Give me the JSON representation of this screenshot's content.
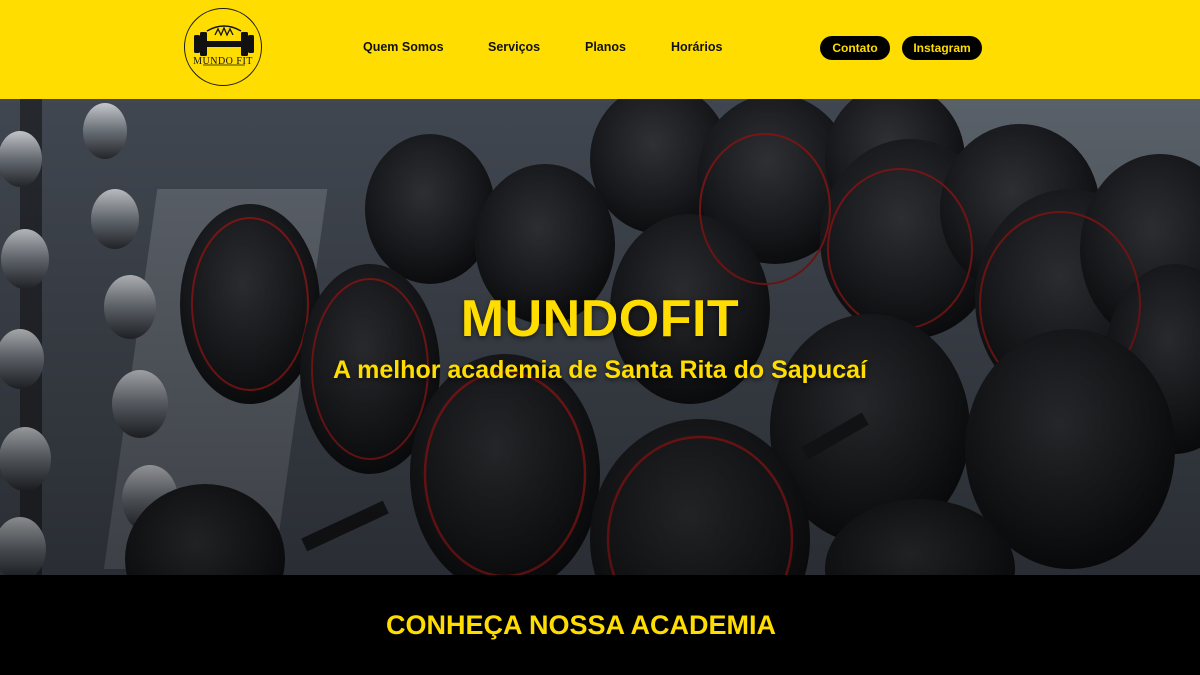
{
  "colors": {
    "brand_yellow": "#ffdd00",
    "black": "#000000"
  },
  "header": {
    "logo": {
      "text": "MUNDO FIT",
      "icon": "dumbbell-icon"
    },
    "nav": [
      {
        "label": "Quem Somos"
      },
      {
        "label": "Serviços"
      },
      {
        "label": "Planos"
      },
      {
        "label": "Horários"
      }
    ],
    "buttons": {
      "contato": "Contato",
      "instagram": "Instagram"
    }
  },
  "hero": {
    "title": "MUNDOFIT",
    "subtitle": "A melhor academia de Santa Rita do Sapucaí",
    "image": "dumbbell-rack-photo"
  },
  "section": {
    "title": "CONHEÇA NOSSA ACADEMIA"
  }
}
